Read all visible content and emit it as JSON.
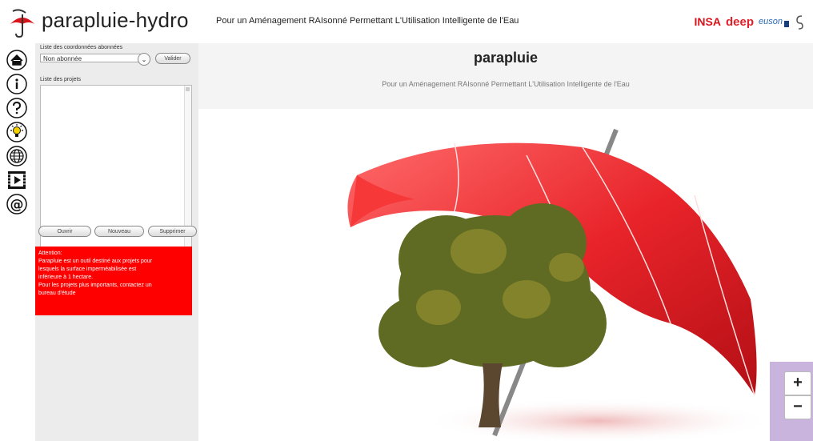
{
  "header": {
    "app_title": "parapluie-hydro",
    "tagline": "Pour un Aménagement RAIsonné Permettant L'Utilisation Intelligente de l'Eau",
    "partners": {
      "insa": "INSA",
      "deep": "deep",
      "euson": "euson"
    }
  },
  "nav_icons": [
    "home-icon",
    "info-icon",
    "help-icon",
    "lightbulb-icon",
    "globe-icon",
    "video-icon",
    "at-icon"
  ],
  "panel": {
    "coord_label": "Liste des coordonnées abonnées",
    "coord_value": "Non abonnée",
    "validate_label": "Valider",
    "projects_label": "Liste des projets",
    "open_label": "Ouvrir",
    "new_label": "Nouveau",
    "delete_label": "Supprimer",
    "warning": {
      "title": "Attention:",
      "line1": "Parapluie est un outil destiné aux projets pour",
      "line2": "lesquels la surface imperméabilisée est",
      "line3": "inférieure à 1 hectare.",
      "line4": "Pour les projets plus importants, contactez un",
      "line5": "bureau d'étude"
    }
  },
  "main": {
    "title": "parapluie",
    "subtitle": "Pour un Aménagement RAIsonné Permettant L'Utilisation Intelligente de l'Eau"
  },
  "map": {
    "zoom_in": "+",
    "zoom_out": "−"
  },
  "colors": {
    "accent_red": "#ff0000",
    "umbrella_red": "#e8242a",
    "panel_gray": "#ececec",
    "map_purple": "#c9b4de"
  }
}
